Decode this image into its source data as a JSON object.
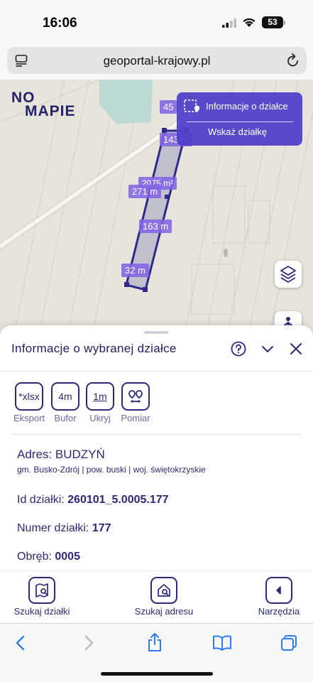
{
  "status_bar": {
    "time": "16:06",
    "battery": "53"
  },
  "browser": {
    "url": "geoportal-krajowy.pl"
  },
  "map": {
    "logo_line1": "NO",
    "logo_line2": "MAPIE",
    "measurements": [
      "45",
      "143 m",
      "2075 m²",
      "271 m",
      "163 m",
      "32 m"
    ],
    "popup": {
      "info_label": "Informacje o działce",
      "show_label": "Wskaż działkę"
    }
  },
  "sheet": {
    "title": "Informacje o wybranej działce",
    "tools": [
      {
        "icon": "*xlsx",
        "label": "Eksport"
      },
      {
        "icon": "4m",
        "label": "Bufor"
      },
      {
        "icon": "1m",
        "label": "Ukryj"
      },
      {
        "icon": "pin-pair-icon",
        "label": "Pomiar"
      }
    ],
    "address_label": "Adres:",
    "address_value": "BUDZYŃ",
    "address_sub": "gm. Busko-Zdrój | pow. buski | woj. świętokrzyskie",
    "parcel_id_label": "Id działki:",
    "parcel_id_value": "260101_5.0005.177",
    "parcel_number_label": "Numer działki:",
    "parcel_number_value": "177",
    "precinct_label": "Obręb:",
    "precinct_value": "0005"
  },
  "bottom_nav": {
    "search_parcel": "Szukaj działki",
    "search_address": "Szukaj adresu",
    "tools": "Narzędzia"
  },
  "colors": {
    "accent": "#2b2978",
    "popup": "#4d3eca",
    "parcel_fill": "#b9b9c9"
  }
}
